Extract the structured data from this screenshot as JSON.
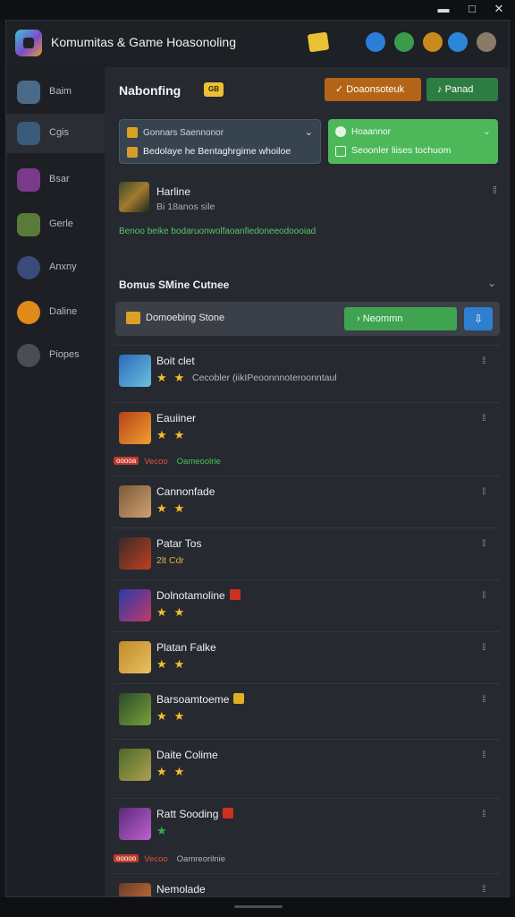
{
  "window": {
    "minimize": "▬",
    "maximize": "□",
    "close": "✕"
  },
  "app": {
    "title": "Komumitas & Game Hoasonoling"
  },
  "header_icons": [
    {
      "name": "globe-icon",
      "color": "#2a7ed8"
    },
    {
      "name": "rose-icon",
      "color": "#3a9c4a"
    },
    {
      "name": "lion-icon",
      "color": "#c98a1c"
    },
    {
      "name": "compass-icon",
      "color": "#2a86d8"
    },
    {
      "name": "user-avatar",
      "color": "#8a7a6a"
    }
  ],
  "sidebar": {
    "items": [
      {
        "label": "Baim",
        "icon": "shield-icon",
        "color": "#4a6a8a"
      },
      {
        "label": "Cgis",
        "icon": "warrior-icon",
        "color": "#3a5a7a"
      },
      {
        "label": "Bsar",
        "icon": "gem-icon",
        "color": "#7a3a8a"
      },
      {
        "label": "Gerle",
        "icon": "map-icon",
        "color": "#5a7a3a"
      },
      {
        "label": "Anxny",
        "icon": "spark-icon",
        "color": "#3a4a7a"
      },
      {
        "label": "Daline",
        "icon": "flame-icon",
        "color": "#e08a1a"
      },
      {
        "label": "Piopes",
        "icon": "people-icon",
        "color": "#4a4d55"
      }
    ]
  },
  "main": {
    "title": "Nabonfing",
    "title_badge": "GB",
    "btn_primary": "Doaonsoteuk",
    "btn_primary_icon": "✓",
    "btn_secondary": "Panad",
    "btn_secondary_icon": "♪",
    "select1": {
      "top": "Gonnars Saennonor",
      "bottom": "Bedolaye he Bentaghrgime whoiloe",
      "chevron": "⌄"
    },
    "select2": {
      "top": "Hoaannor",
      "bottom": "Seoonler liises tochuom",
      "chevron": "⌄"
    }
  },
  "featured": {
    "name": "Harline",
    "meta": "Bi 18anos sile",
    "desc": "Benoo beike bodaruonwolfaoanfiedoneeodoooiad",
    "more": "⁞⁞"
  },
  "section": {
    "title": "Bomus SMine Cutnee",
    "chevron": "⌄"
  },
  "filter": {
    "label": "Domoebing Stone",
    "button": "Neommn",
    "button_icon": "›",
    "square": "⇩"
  },
  "games": [
    {
      "name": "Boit clet",
      "stars": "★★",
      "sub": "Cecobler (iikIPeoonnnoteroonntaul",
      "thumb": [
        "#2a6ab8",
        "#6ac0e0"
      ],
      "more": "⁞⁞"
    },
    {
      "name": "Eauiiner",
      "stars": "★★",
      "tag_pill": "ooooa",
      "tag_red": "Vecoo",
      "tag_green": "Oameoolrie",
      "thumb": [
        "#b8401a",
        "#f0a030"
      ],
      "more": "⁞⁞"
    },
    {
      "name": "Cannonfade",
      "stars": "★★",
      "thumb": [
        "#7a5a3a",
        "#d0a070"
      ],
      "more": "⁞⁞"
    },
    {
      "name": "Patar Tos",
      "sub_plain": "2lt Cdr",
      "thumb": [
        "#3a2a2a",
        "#c04020"
      ],
      "more": "⁞⁞"
    },
    {
      "name": "Dolnotamoline",
      "flag": "#d03020",
      "stars": "★★",
      "thumb": [
        "#2a3aa8",
        "#c03a6a"
      ],
      "more": "⁞⁞"
    },
    {
      "name": "Platan Falke",
      "stars": "★★",
      "thumb": [
        "#c08a2a",
        "#e8c060"
      ],
      "more": "⁞⁞"
    },
    {
      "name": "Barsoamtoeme",
      "flag": "#e0b020",
      "stars": "★★",
      "thumb": [
        "#2a4a2a",
        "#7aa03a"
      ],
      "more": "⁞⁞"
    },
    {
      "name": "Daite Colime",
      "stars": "★★",
      "thumb": [
        "#4a6a2a",
        "#b0a050"
      ],
      "more": "⁞⁞"
    },
    {
      "name": "Ratt Sooding",
      "flag": "#d03020",
      "stars": "★",
      "star_color": "#3aa84a",
      "tag_pill": "ooooo",
      "tag_red": "Vecoo",
      "tag_gray": "Oamreorilnie",
      "thumb": [
        "#5a2a7a",
        "#c060d0"
      ],
      "more": "⁞⁞"
    },
    {
      "name": "Nemolade",
      "stars": "★★",
      "thumb": [
        "#6a3a2a",
        "#d07a3a"
      ],
      "more": "⁞⁞"
    }
  ]
}
